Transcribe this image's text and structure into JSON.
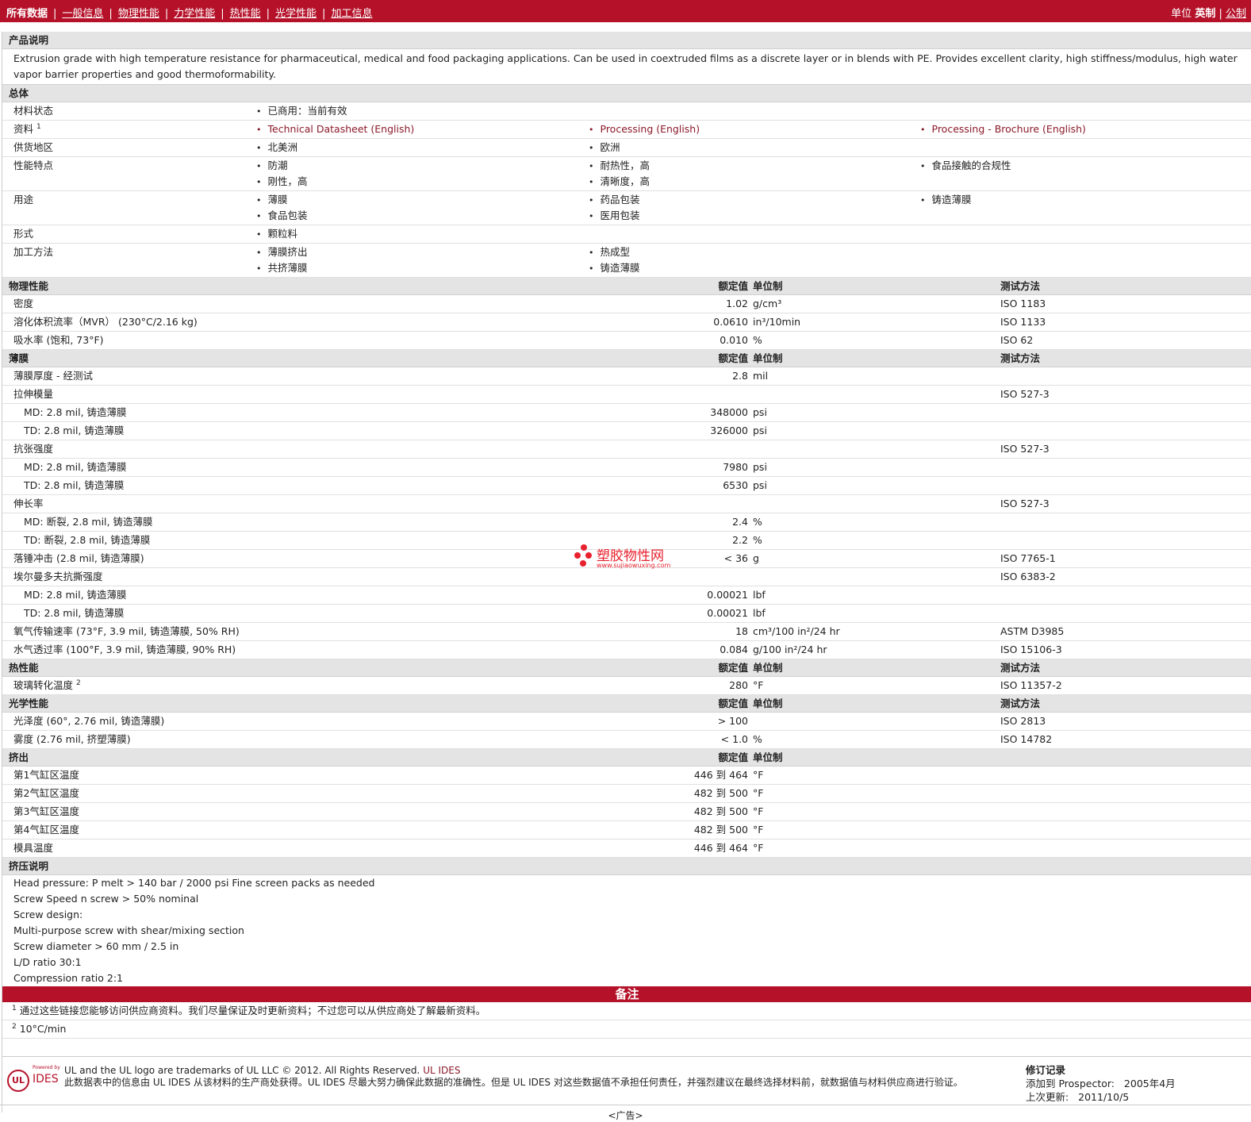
{
  "topbar": {
    "tabs": [
      "所有数据",
      "一般信息",
      "物理性能",
      "力学性能",
      "热性能",
      "光学性能",
      "加工信息"
    ],
    "units_label": "单位",
    "unit_english": "英制",
    "unit_metric": "公制"
  },
  "sections": {
    "product_desc": "产品说明",
    "general": "总体",
    "physical": "物理性能",
    "film": "薄膜",
    "thermal": "热性能",
    "optical": "光学性能",
    "extrusion": "挤出",
    "extrusion_notes": "挤压说明",
    "notes": "备注"
  },
  "headers": {
    "value": "额定值",
    "unit": "单位制",
    "method": "测试方法"
  },
  "description": "Extrusion grade with high temperature resistance for pharmaceutical, medical and food packaging applications. Can be used in coextruded films as a discrete layer or in blends with PE. Provides excellent clarity, high stiffness/modulus, high water vapor barrier properties and good thermoformability.",
  "general": {
    "status": {
      "label": "材料状态",
      "c1": [
        "已商用：当前有效"
      ]
    },
    "docs": {
      "label": "资料",
      "sup": "1",
      "c1": [
        "Technical Datasheet (English)"
      ],
      "c2": [
        "Processing (English)"
      ],
      "c3": [
        "Processing - Brochure (English)"
      ]
    },
    "region": {
      "label": "供货地区",
      "c1": [
        "北美洲"
      ],
      "c2": [
        "欧洲"
      ]
    },
    "features": {
      "label": "性能特点",
      "c1": [
        "防潮",
        "刚性，高"
      ],
      "c2": [
        "耐热性，高",
        "清晰度，高"
      ],
      "c3": [
        "食品接触的合规性"
      ]
    },
    "uses": {
      "label": "用途",
      "c1": [
        "薄膜",
        "食品包装"
      ],
      "c2": [
        "药品包装",
        "医用包装"
      ],
      "c3": [
        "铸造薄膜"
      ]
    },
    "form": {
      "label": "形式",
      "c1": [
        "颗粒料"
      ]
    },
    "processing": {
      "label": "加工方法",
      "c1": [
        "薄膜挤出",
        "共挤薄膜"
      ],
      "c2": [
        "热成型",
        "铸造薄膜"
      ]
    }
  },
  "physical_rows": [
    {
      "label": "密度",
      "value": "1.02",
      "unit": "g/cm³",
      "method": "ISO 1183"
    },
    {
      "label": "溶化体积流率（MVR） (230°C/2.16 kg)",
      "value": "0.0610",
      "unit": "in³/10min",
      "method": "ISO 1133"
    },
    {
      "label": "吸水率 (饱和, 73°F)",
      "value": "0.010",
      "unit": "%",
      "method": "ISO 62"
    }
  ],
  "film_rows": [
    {
      "label": "薄膜厚度 - 经测试",
      "value": "2.8",
      "unit": "mil",
      "method": ""
    },
    {
      "label": "拉伸模量",
      "value": "",
      "unit": "",
      "method": "ISO 527-3"
    },
    {
      "label": "MD: 2.8 mil, 铸造薄膜",
      "sub": true,
      "value": "348000",
      "unit": "psi",
      "method": ""
    },
    {
      "label": "TD: 2.8 mil, 铸造薄膜",
      "sub": true,
      "value": "326000",
      "unit": "psi",
      "method": ""
    },
    {
      "label": "抗张强度",
      "value": "",
      "unit": "",
      "method": "ISO 527-3"
    },
    {
      "label": "MD: 2.8 mil, 铸造薄膜",
      "sub": true,
      "value": "7980",
      "unit": "psi",
      "method": ""
    },
    {
      "label": "TD: 2.8 mil, 铸造薄膜",
      "sub": true,
      "value": "6530",
      "unit": "psi",
      "method": ""
    },
    {
      "label": "伸长率",
      "value": "",
      "unit": "",
      "method": "ISO 527-3"
    },
    {
      "label": "MD: 断裂, 2.8 mil, 铸造薄膜",
      "sub": true,
      "value": "2.4",
      "unit": "%",
      "method": ""
    },
    {
      "label": "TD: 断裂, 2.8 mil, 铸造薄膜",
      "sub": true,
      "value": "2.2",
      "unit": "%",
      "method": ""
    },
    {
      "label": "落锤冲击 (2.8 mil, 铸造薄膜)",
      "value": "< 36",
      "unit": "g",
      "method": "ISO 7765-1"
    },
    {
      "label": "埃尔曼多夫抗撕强度",
      "value": "",
      "unit": "",
      "method": "ISO 6383-2"
    },
    {
      "label": "MD: 2.8 mil, 铸造薄膜",
      "sub": true,
      "value": "0.00021",
      "unit": "lbf",
      "method": ""
    },
    {
      "label": "TD: 2.8 mil, 铸造薄膜",
      "sub": true,
      "value": "0.00021",
      "unit": "lbf",
      "method": ""
    },
    {
      "label": "氧气传输速率 (73°F, 3.9 mil, 铸造薄膜, 50% RH)",
      "value": "18",
      "unit": "cm³/100 in²/24 hr",
      "method": "ASTM D3985"
    },
    {
      "label": "水气透过率 (100°F, 3.9 mil, 铸造薄膜, 90% RH)",
      "value": "0.084",
      "unit": "g/100 in²/24 hr",
      "method": "ISO 15106-3"
    }
  ],
  "thermal_rows": [
    {
      "label": "玻璃转化温度",
      "sup": "2",
      "value": "280",
      "unit": "°F",
      "method": "ISO 11357-2"
    }
  ],
  "optical_rows": [
    {
      "label": "光泽度 (60°, 2.76 mil, 铸造薄膜)",
      "value": "> 100",
      "unit": "",
      "method": "ISO 2813"
    },
    {
      "label": "雾度 (2.76 mil, 挤塑薄膜)",
      "value": "< 1.0",
      "unit": "%",
      "method": "ISO 14782"
    }
  ],
  "extrusion_rows": [
    {
      "label": "第1气缸区温度",
      "value": "446 到 464",
      "unit": "°F"
    },
    {
      "label": "第2气缸区温度",
      "value": "482 到 500",
      "unit": "°F"
    },
    {
      "label": "第3气缸区温度",
      "value": "482 到 500",
      "unit": "°F"
    },
    {
      "label": "第4气缸区温度",
      "value": "482 到 500",
      "unit": "°F"
    },
    {
      "label": "模具温度",
      "value": "446 到 464",
      "unit": "°F"
    }
  ],
  "extrusion_notes": [
    "Head pressure: P melt > 140 bar / 2000 psi Fine screen packs as needed",
    "Screw Speed n screw > 50% nominal",
    "Screw design:",
    "Multi-purpose screw with shear/mixing section",
    "Screw diameter > 60 mm / 2.5 in",
    "L/D ratio 30:1",
    "Compression ratio 2:1"
  ],
  "footnotes": [
    {
      "num": "1",
      "text": "通过这些链接您能够访问供应商资料。我们尽量保证及时更新资料；不过您可以从供应商处了解最新资料。"
    },
    {
      "num": "2",
      "text": "10°C/min"
    }
  ],
  "footer": {
    "trademark": "UL and the UL logo are trademarks of UL LLC © 2012. All Rights Reserved.",
    "ul_ides_link": "UL IDES",
    "disclaimer": "此数据表中的信息由 UL IDES 从该材料的生产商处获得。UL IDES 尽最大努力确保此数据的准确性。但是 UL IDES 对这些数据值不承担任何责任，并强烈建议在最终选择材料前，就数据值与材料供应商进行验证。",
    "logo_ul": "UL",
    "logo_ides": "IDES",
    "logo_powered": "Powered by",
    "revision_title": "修订记录",
    "added_label": "添加到 Prospector:",
    "added_date": "2005年4月",
    "updated_label": "上次更新:",
    "updated_date": "2011/10/5"
  },
  "ad_text": "<广告>",
  "watermark": {
    "name": "塑胶物性网",
    "url": "www.sujiaowuxing.com"
  }
}
